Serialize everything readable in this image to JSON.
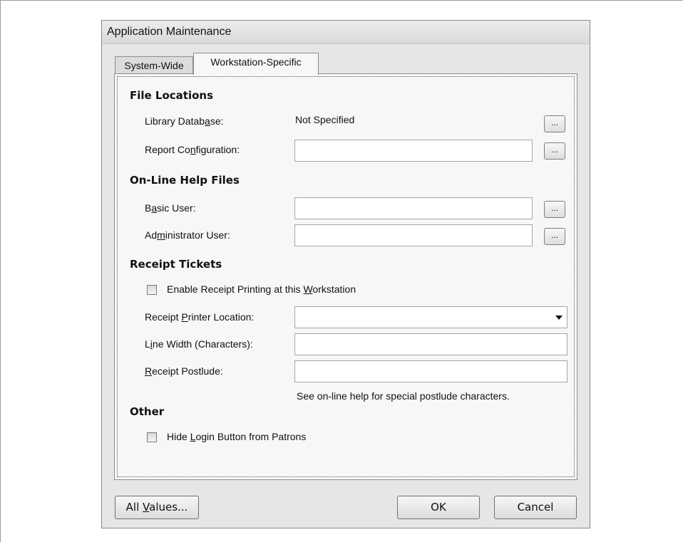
{
  "window": {
    "title": "Application Maintenance"
  },
  "tabs": [
    {
      "label": "System-Wide",
      "active": false
    },
    {
      "label": "Workstation-Specific",
      "active": true
    }
  ],
  "file_locations": {
    "heading": "File Locations",
    "library_database": {
      "label_pre": "Library Datab",
      "label_key": "a",
      "label_post": "se:",
      "value": "Not Specified",
      "browse": "..."
    },
    "report_configuration": {
      "label_pre": "Report Co",
      "label_key": "n",
      "label_post": "figuration:",
      "value": "",
      "browse": "..."
    }
  },
  "help_files": {
    "heading": "On-Line Help Files",
    "basic_user": {
      "label_pre": "B",
      "label_key": "a",
      "label_post": "sic User:",
      "value": "",
      "browse": "..."
    },
    "administrator_user": {
      "label_pre": "Ad",
      "label_key": "m",
      "label_post": "inistrator User:",
      "value": "",
      "browse": "..."
    }
  },
  "receipt_tickets": {
    "heading": "Receipt Tickets",
    "enable_printing": {
      "label_pre": "Enable Receipt Printing at this ",
      "label_key": "W",
      "label_post": "orkstation",
      "checked": false
    },
    "printer_location": {
      "label_pre": "Receipt ",
      "label_key": "P",
      "label_post": "rinter Location:",
      "value": ""
    },
    "line_width": {
      "label_pre": "L",
      "label_key": "i",
      "label_post": "ne Width (Characters):",
      "value": ""
    },
    "postlude": {
      "label_pre": "",
      "label_key": "R",
      "label_post": "eceipt Postlude:",
      "value": ""
    },
    "hint": "See on-line help for special postlude characters."
  },
  "other": {
    "heading": "Other",
    "hide_login": {
      "label_pre": "Hide ",
      "label_key": "L",
      "label_post": "ogin Button from Patrons",
      "checked": false
    }
  },
  "buttons": {
    "all_values": {
      "label_pre": "All ",
      "label_key": "V",
      "label_post": "alues..."
    },
    "ok": "OK",
    "cancel": "Cancel"
  }
}
